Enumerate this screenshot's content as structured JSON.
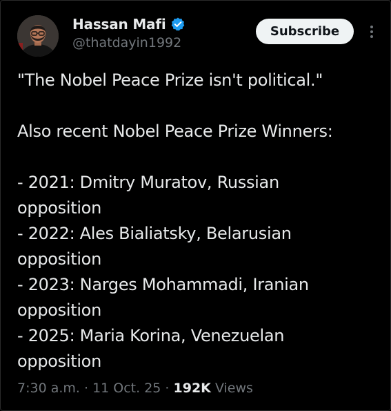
{
  "author": {
    "display_name": "Hassan Mafi",
    "handle": "@thatdayin1992",
    "verified_icon": "verified-badge-icon",
    "avatar_icon": "avatar"
  },
  "actions": {
    "subscribe_label": "Subscribe",
    "more_icon": "more-vertical-icon"
  },
  "tweet": {
    "lines": [
      "\"The Nobel Peace Prize isn't political.\"",
      "",
      "Also recent Nobel Peace Prize Winners:",
      "",
      "- 2021: Dmitry Muratov, Russian",
      "opposition",
      "- 2022: Ales Bialiatsky, Belarusian",
      "opposition",
      "- 2023: Narges Mohammadi, Iranian",
      "opposition",
      "- 2025: Maria Korina, Venezuelan",
      "opposition"
    ]
  },
  "meta": {
    "time": "7:30 a.m.",
    "separator": " · ",
    "date": "11 Oct. 25",
    "views_count": "192K",
    "views_label": "Views"
  },
  "colors": {
    "background": "#000000",
    "text_primary": "#e7e9ea",
    "text_secondary": "#71767b",
    "verified_blue": "#1d9bf0",
    "button_bg": "#eff3f4"
  }
}
